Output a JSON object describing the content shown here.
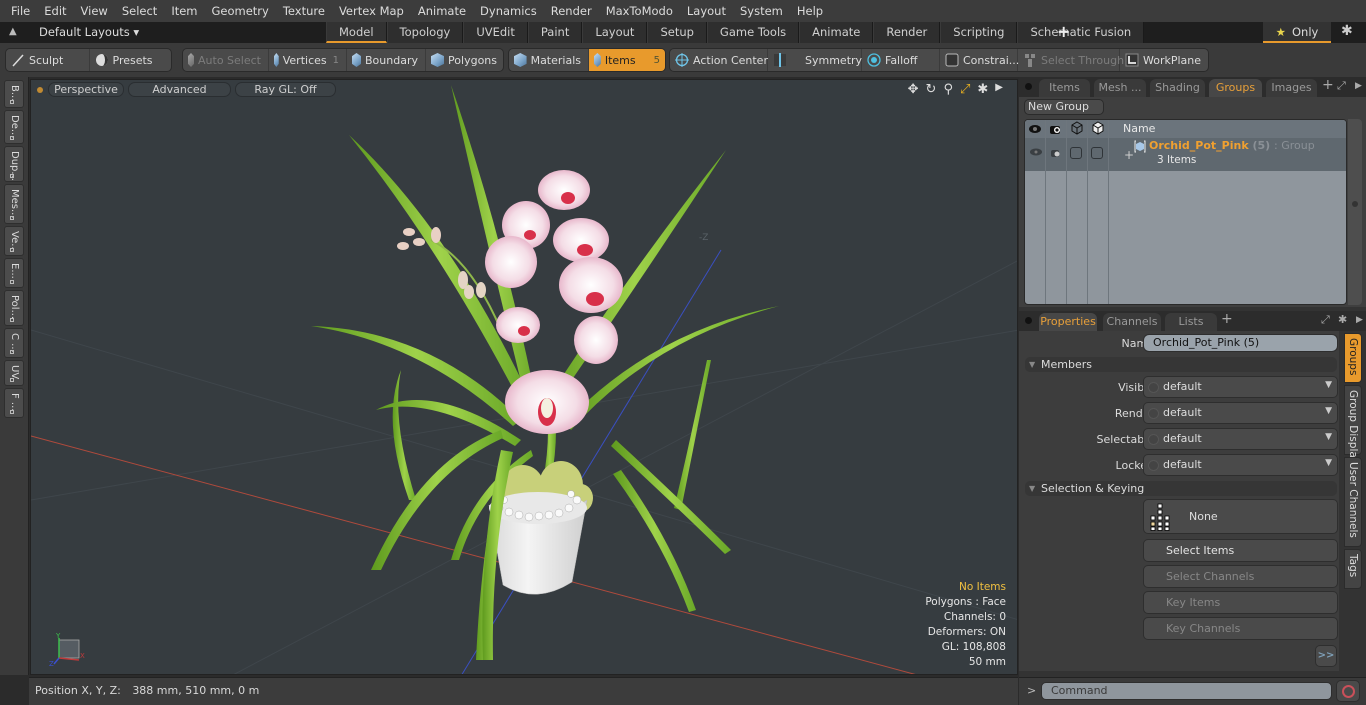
{
  "menu": [
    "File",
    "Edit",
    "View",
    "Select",
    "Item",
    "Geometry",
    "Texture",
    "Vertex Map",
    "Animate",
    "Dynamics",
    "Render",
    "MaxToModo",
    "Layout",
    "System",
    "Help"
  ],
  "layoutbar": {
    "default_layouts": "Default Layouts ▾",
    "tabs": [
      "Model",
      "Topology",
      "UVEdit",
      "Paint",
      "Layout",
      "Setup",
      "Game Tools",
      "Animate",
      "Render",
      "Scripting",
      "Schematic Fusion"
    ],
    "active_tab": "Model",
    "add_tab": "+",
    "only_label": "Only",
    "star": "★"
  },
  "toolbar": {
    "sculpt": "Sculpt",
    "presets": "Presets",
    "auto_select": "Auto Select",
    "vertices": "Vertices",
    "vertices_count": "1",
    "boundary": "Boundary",
    "polygons": "Polygons",
    "materials": "Materials",
    "items": "Items",
    "items_count": "5",
    "action_center": "Action Center",
    "symmetry": "Symmetry",
    "falloff": "Falloff",
    "constraints": "Constrai...",
    "select_through": "Select Through",
    "workplane": "WorkPlane"
  },
  "left_tabs": [
    "B...",
    "De...",
    "Dup...",
    "Mes...",
    "Ve...",
    "E...",
    "Pol...",
    "C ...",
    "UV",
    "F ..."
  ],
  "viewport": {
    "view_mode": "Perspective",
    "shading": "Advanced",
    "raygl": "Ray GL: Off",
    "axis_label": "-Z",
    "info": {
      "selection": "No Items",
      "polygons": "Polygons : Face",
      "channels": "Channels: 0",
      "deformers": "Deformers: ON",
      "gl": "GL: 108,808",
      "grid": "50 mm"
    },
    "gizmo": {
      "x": "X",
      "y": "Y",
      "z": "Z"
    }
  },
  "status": {
    "position_label": "Position X, Y, Z:",
    "position_value": "388 mm, 510 mm, 0 m"
  },
  "groups_panel": {
    "tabs": [
      "Items",
      "Mesh ...",
      "Shading",
      "Groups",
      "Images"
    ],
    "active_tab": "Groups",
    "new_group": "New Group",
    "column_name": "Name",
    "group": {
      "name": "Orchid_Pot_Pink",
      "count": "(5)",
      "type": ": Group",
      "items": "3 Items"
    }
  },
  "properties_panel": {
    "tabs": [
      "Properties",
      "Channels",
      "Lists"
    ],
    "active_tab": "Properties",
    "name_label": "Name",
    "name_value": "Orchid_Pot_Pink (5)",
    "members_section": "Members",
    "fields": [
      {
        "label": "Visible",
        "value": "default"
      },
      {
        "label": "Render",
        "value": "default"
      },
      {
        "label": "Selectable",
        "value": "default"
      },
      {
        "label": "Locked",
        "value": "default"
      }
    ],
    "selection_section": "Selection & Keying",
    "none_button": "None",
    "buttons": [
      {
        "label": "Select Items",
        "enabled": true
      },
      {
        "label": "Select Channels",
        "enabled": false
      },
      {
        "label": "Key Items",
        "enabled": false
      },
      {
        "label": "Key Channels",
        "enabled": false
      }
    ],
    "more_button": ">>",
    "side_tabs": [
      "Groups",
      "Group Display",
      "User Channels",
      "Tags"
    ],
    "active_side_tab": "Groups"
  },
  "command": {
    "prompt": ">",
    "placeholder": "Command"
  },
  "colors": {
    "accent": "#e89a2c",
    "group_name": "#f0a030",
    "warn_text": "#f0c040"
  }
}
